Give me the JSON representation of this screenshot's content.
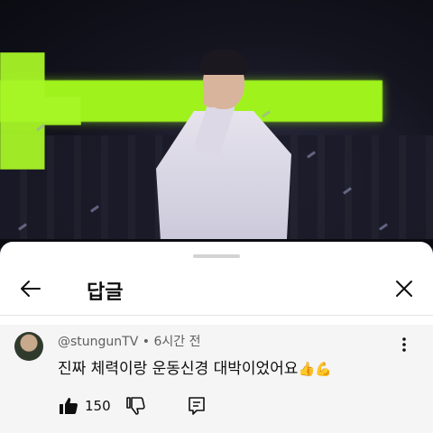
{
  "video": {
    "accent_color": "#9ff21c"
  },
  "sheet": {
    "title": "답글",
    "back_icon": "arrow-left-icon",
    "close_icon": "close-icon"
  },
  "comment": {
    "author": "@stungunTV",
    "separator": "•",
    "time": "6시간 전",
    "text": "진짜 체력이랑 운동신경 대박이었어요",
    "emojis": [
      "👍",
      "💪"
    ],
    "like_count": "150",
    "icons": [
      "thumb-up-icon",
      "thumb-down-icon",
      "reply-icon",
      "more-vert-icon"
    ]
  }
}
